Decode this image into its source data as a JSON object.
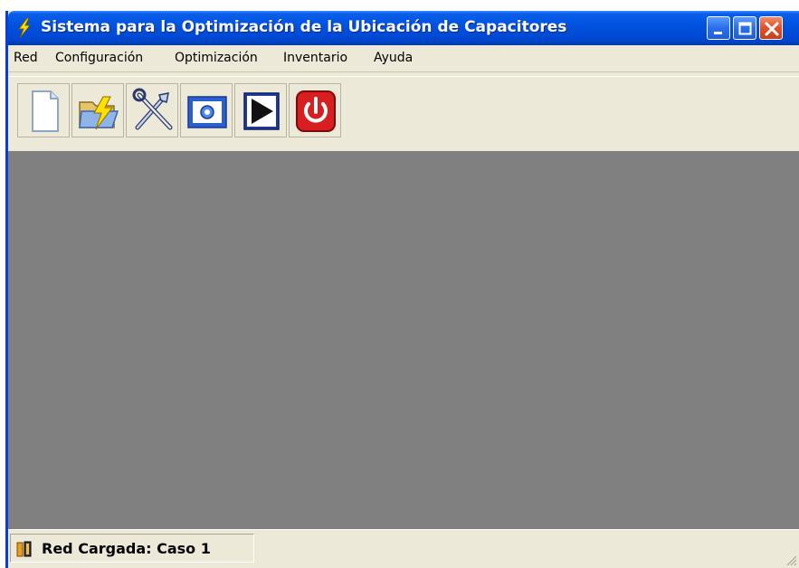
{
  "window": {
    "title": "Sistema para la Optimización de la Ubicación de Capacitores",
    "title_icon": "lightning-bolt-icon"
  },
  "menu": {
    "items": [
      {
        "label": "Red"
      },
      {
        "label": "Configuración"
      },
      {
        "label": "Optimización"
      },
      {
        "label": "Inventario"
      },
      {
        "label": "Ayuda"
      }
    ]
  },
  "toolbar": {
    "buttons": [
      {
        "icon": "new-document-icon"
      },
      {
        "icon": "open-folder-icon"
      },
      {
        "icon": "tools-icon"
      },
      {
        "icon": "settings-window-icon"
      },
      {
        "icon": "run-play-icon"
      },
      {
        "icon": "power-icon"
      }
    ]
  },
  "status": {
    "text": "Red Cargada: Caso 1",
    "icon": "network-loaded-icon"
  },
  "colors": {
    "titlebar": "#0053e0",
    "client_area": "#808080",
    "chrome": "#ece9d8",
    "close_button": "#e0502a"
  }
}
